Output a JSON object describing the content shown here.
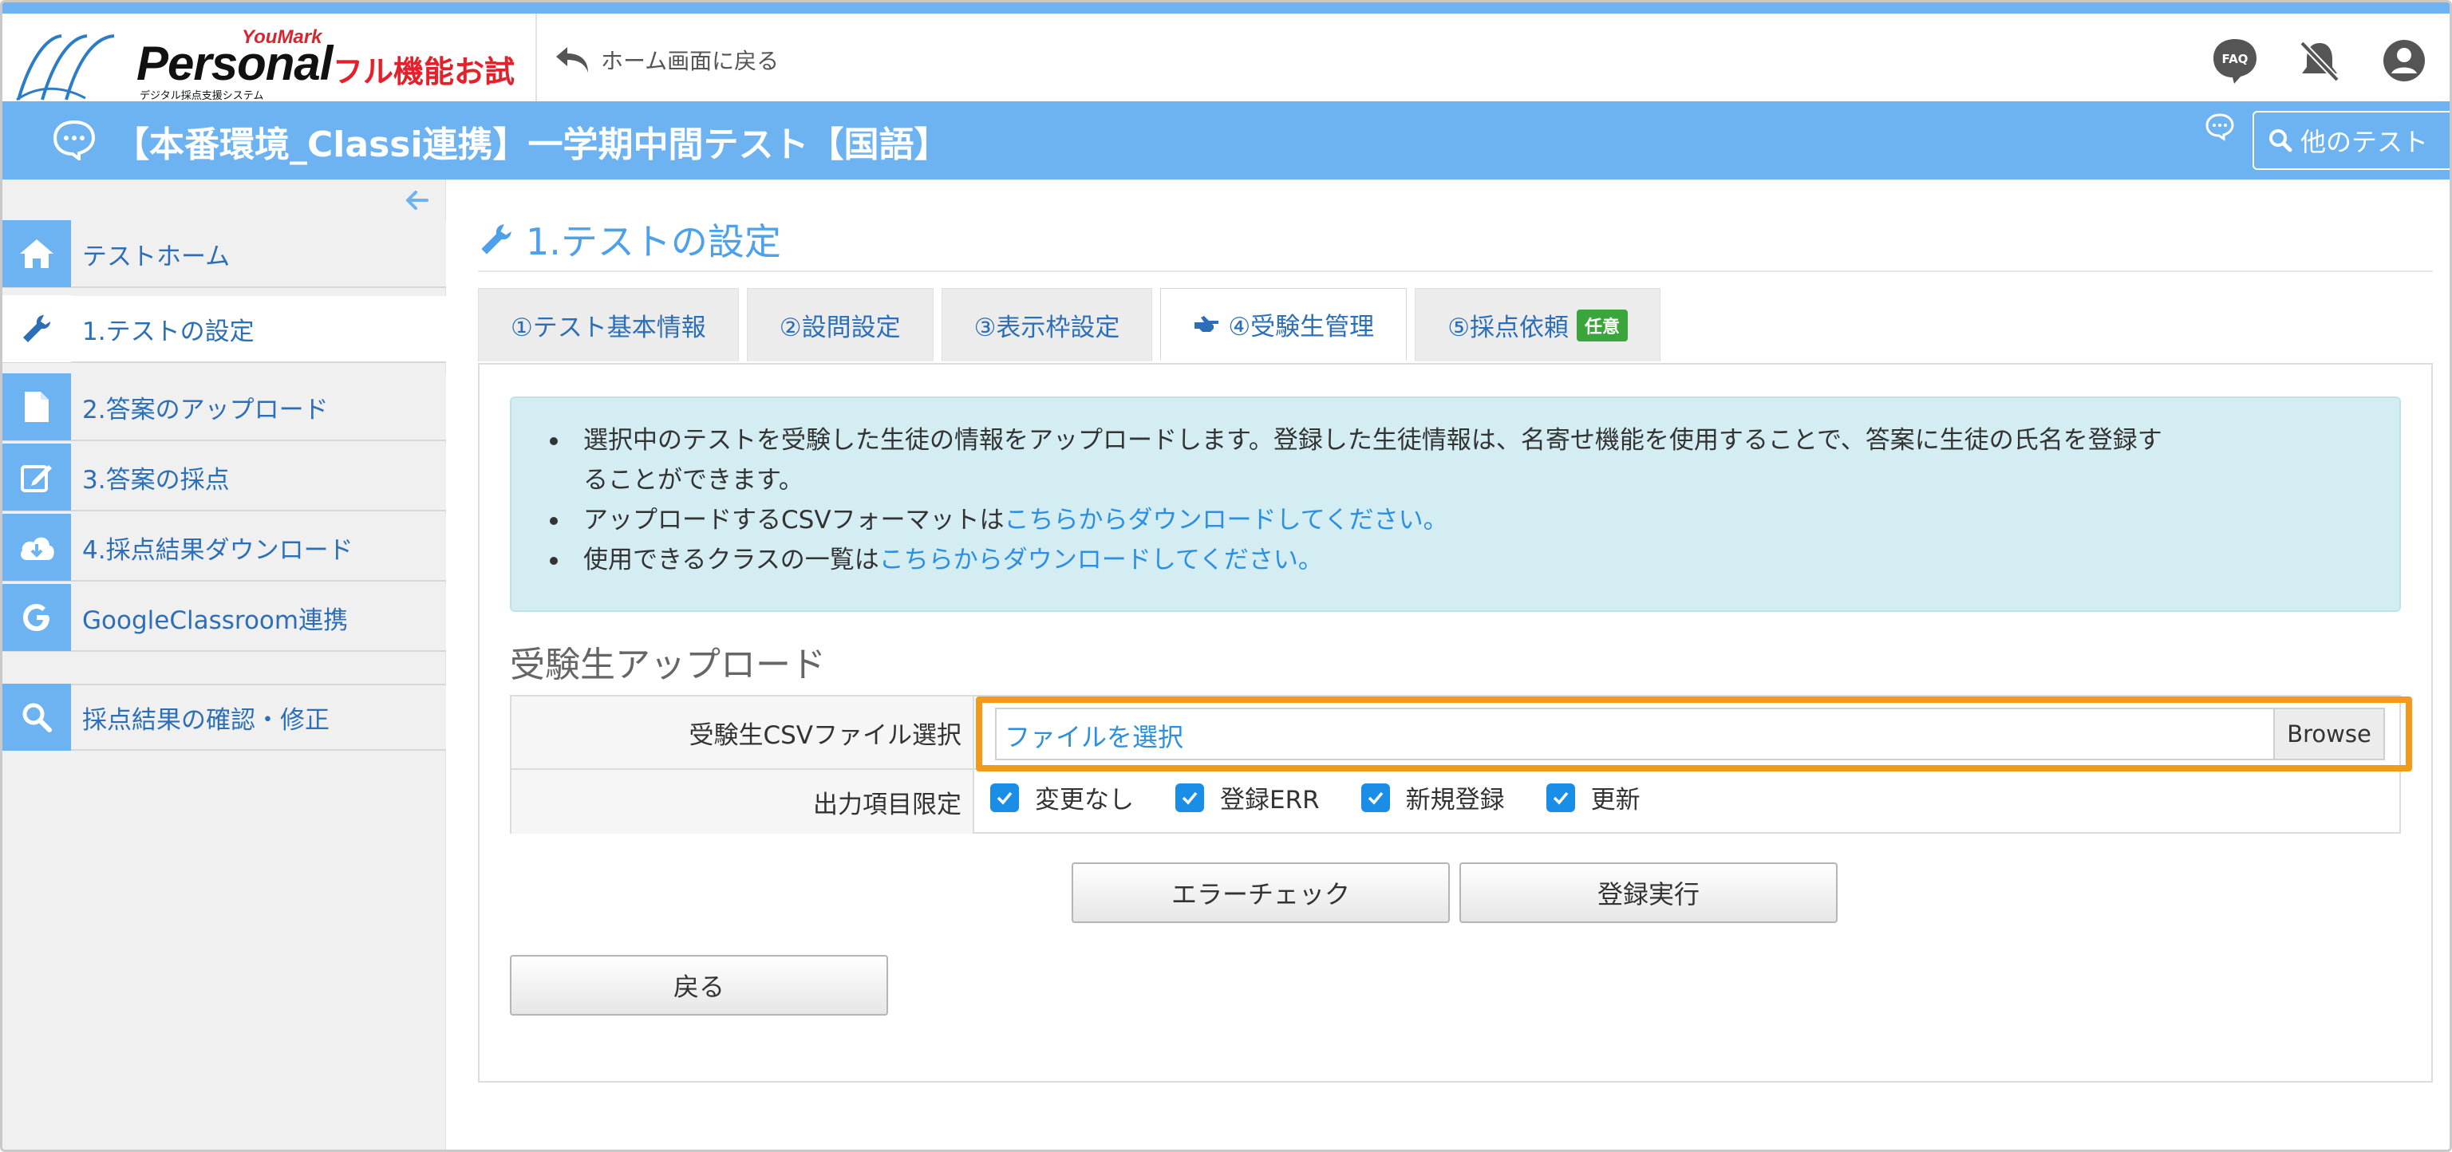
{
  "header": {
    "brand_top": "YouMark",
    "brand": "Personal",
    "brand_sub": "デジタル採点支援システム",
    "trial_label": "フル機能お試し",
    "back_home_label": "ホーム画面に戻る",
    "icons": [
      "faq-icon",
      "notification-off-icon",
      "user-account-icon"
    ],
    "faq_text": "FAQ"
  },
  "titlebar": {
    "title": "【本番環境_Classi連携】一学期中間テスト【国語】",
    "other_test_label": "他のテスト"
  },
  "sidebar": {
    "items": [
      {
        "label": "テストホーム",
        "icon": "home-icon"
      },
      {
        "label": "1.テストの設定",
        "icon": "wrench-icon",
        "active": true
      },
      {
        "label": "2.答案のアップロード",
        "icon": "file-icon"
      },
      {
        "label": "3.答案の採点",
        "icon": "edit-icon"
      },
      {
        "label": "4.採点結果ダウンロード",
        "icon": "cloud-download-icon"
      },
      {
        "label": "GoogleClassroom連携",
        "icon": "google-icon"
      },
      {
        "label": "採点結果の確認・修正",
        "icon": "search-icon"
      }
    ]
  },
  "main": {
    "page_title": "1.テストの設定",
    "tabs": [
      {
        "label": "①テスト基本情報"
      },
      {
        "label": "②設問設定"
      },
      {
        "label": "③表示枠設定"
      },
      {
        "label": "④受験生管理",
        "active": true
      },
      {
        "label": "⑤採点依頼",
        "badge": "任意"
      }
    ],
    "info": {
      "line1": "選択中のテストを受験した生徒の情報をアップロードします。登録した生徒情報は、名寄せ機能を使用することで、答案に生徒の氏名を登録す",
      "line1b": "ることができます。",
      "line2_prefix": "アップロードするCSVフォーマットは",
      "line2_link": "こちらからダウンロードしてください。",
      "line3_prefix": "使用できるクラスの一覧は",
      "line3_link": "こちらからダウンロードしてください。"
    },
    "section_title": "受験生アップロード",
    "form": {
      "file_label": "受験生CSVファイル選択",
      "file_placeholder": "ファイルを選択",
      "browse_label": "Browse",
      "filter_label": "出力項目限定",
      "checkboxes": [
        {
          "label": "変更なし",
          "checked": true
        },
        {
          "label": "登録ERR",
          "checked": true
        },
        {
          "label": "新規登録",
          "checked": true
        },
        {
          "label": "更新",
          "checked": true
        }
      ]
    },
    "buttons": {
      "error_check": "エラーチェック",
      "register": "登録実行",
      "back": "戻る"
    }
  },
  "colors": {
    "header_blue": "#6db3f2",
    "link_blue": "#2d8fe0",
    "highlight_orange": "#f29a1a",
    "info_bg": "#d3edf2",
    "badge_green": "#3aa53a",
    "trial_red": "#e4202a"
  }
}
